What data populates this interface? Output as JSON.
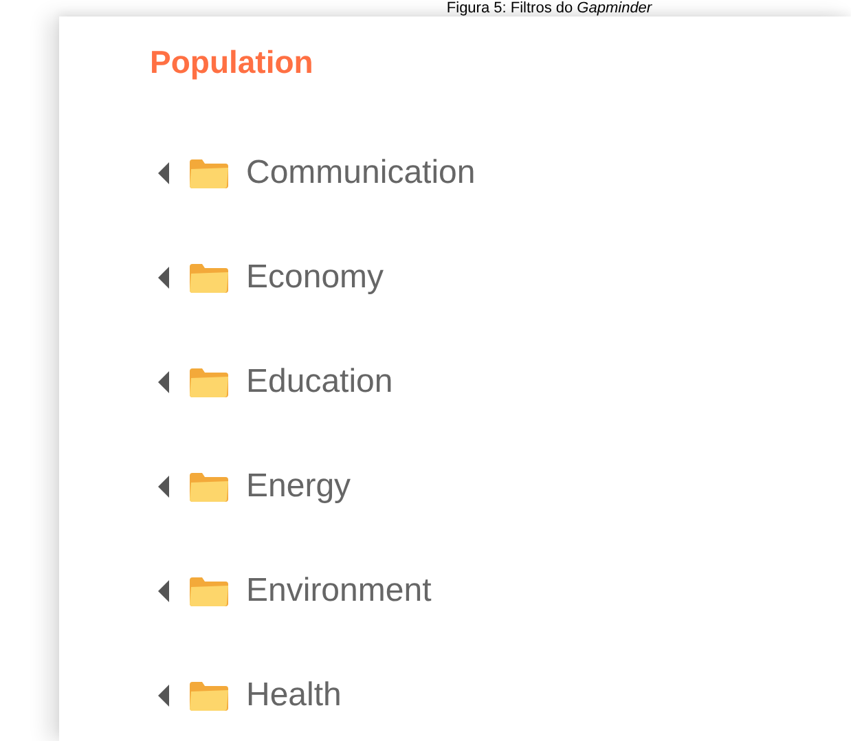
{
  "caption": "Figura 5: Filtros do *Gapminder*",
  "panel": {
    "heading": "Population",
    "folders": [
      {
        "label": "Communication",
        "expanded": false
      },
      {
        "label": "Economy",
        "expanded": false
      },
      {
        "label": "Education",
        "expanded": false
      },
      {
        "label": "Energy",
        "expanded": false
      },
      {
        "label": "Environment",
        "expanded": false
      },
      {
        "label": "Health",
        "expanded": false
      }
    ]
  }
}
